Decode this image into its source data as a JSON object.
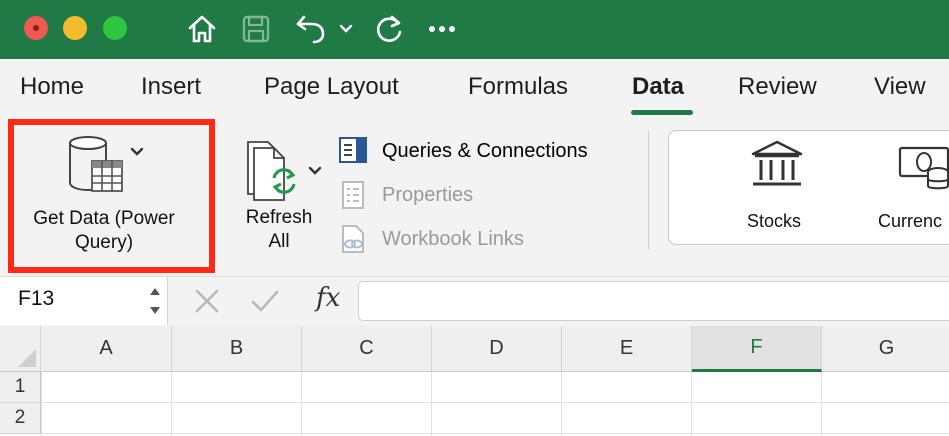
{
  "ribbon_tabs": [
    {
      "label": "Home"
    },
    {
      "label": "Insert"
    },
    {
      "label": "Page Layout"
    },
    {
      "label": "Formulas"
    },
    {
      "label": "Data",
      "active": true
    },
    {
      "label": "Review"
    },
    {
      "label": "View"
    }
  ],
  "get_data": {
    "line1": "Get Data (Power",
    "line2": "Query)",
    "highlight_color": "#ff2a15"
  },
  "refresh": {
    "line1": "Refresh",
    "line2": "All"
  },
  "queries_group": {
    "queries_connections": "Queries & Connections",
    "properties": "Properties",
    "workbook_links": "Workbook Links"
  },
  "data_types": {
    "stocks": "Stocks",
    "currencies": "Currenc"
  },
  "formula_bar": {
    "name_box": "F13",
    "fx_label": "fx"
  },
  "columns": [
    "A",
    "B",
    "C",
    "D",
    "E",
    "F",
    "G"
  ],
  "selected_column": "F",
  "rows": [
    "1",
    "2"
  ],
  "colors": {
    "title_bar": "#1f7a45",
    "accent": "#1f7a45"
  }
}
